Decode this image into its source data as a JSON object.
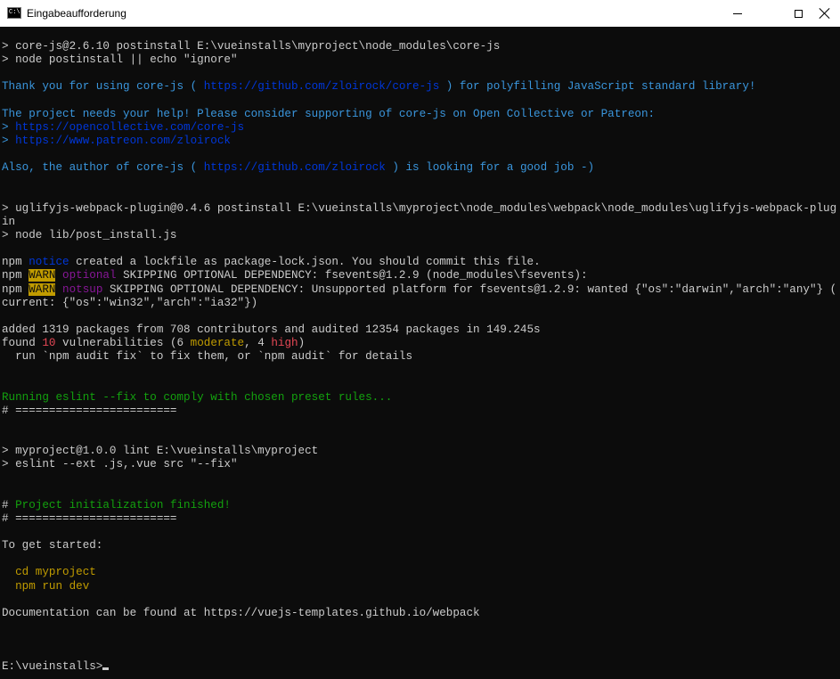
{
  "window": {
    "title": "Eingabeaufforderung",
    "app_icon_text": "C:\\",
    "minimize_glyph": "minimize-icon",
    "maximize_glyph": "maximize-icon",
    "close_glyph": "close-icon"
  },
  "colors": {
    "background": "#0c0c0c",
    "text": "#cccccc",
    "cyan": "#3a96dd",
    "link_blue": "#0037da",
    "yellow": "#c19c00",
    "green": "#13a10e",
    "magenta": "#881798",
    "red": "#e74856"
  },
  "console": {
    "l1": "> core-js@2.6.10 postinstall E:\\vueinstalls\\myproject\\node_modules\\core-js",
    "l2": "> node postinstall || echo \"ignore\"",
    "l3a": "Thank you for using core-js ( ",
    "l3b": "https://github.com/zloirock/core-js",
    "l3c": " ) for polyfilling JavaScript standard library!",
    "l4": "The project needs your help! Please consider supporting of core-js on Open Collective or Patreon:",
    "l5a": "> ",
    "l5b": "https://opencollective.com/core-js",
    "l6a": "> ",
    "l6b": "https://www.patreon.com/zloirock",
    "l7a": "Also, the author of core-js ( ",
    "l7b": "https://github.com/zloirock",
    "l7c": " ) is looking for a good job -)",
    "l8": "> uglifyjs-webpack-plugin@0.4.6 postinstall E:\\vueinstalls\\myproject\\node_modules\\webpack\\node_modules\\uglifyjs-webpack-plug",
    "l9": "in",
    "l10": "> node lib/post_install.js",
    "npm": "npm",
    "notice": "notice",
    "l11": " created a lockfile as package-lock.json. You should commit this file.",
    "warn": "WARN",
    "optional": "optional",
    "l12": " SKIPPING OPTIONAL DEPENDENCY: fsevents@1.2.9 (node_modules\\fsevents):",
    "notsup": "notsup",
    "l13": " SKIPPING OPTIONAL DEPENDENCY: Unsupported platform for fsevents@1.2.9: wanted {\"os\":\"darwin\",\"arch\":\"any\"} (",
    "l14": "current: {\"os\":\"win32\",\"arch\":\"ia32\"})",
    "l15": "added 1319 packages from 708 contributors and audited 12354 packages in 149.245s",
    "l16a": "found ",
    "l16b": "10",
    "l16c": " vulnerabilities (6 ",
    "l16d": "moderate",
    "l16e": ", 4 ",
    "l16f": "high",
    "l16g": ")",
    "l17": "  run `npm audit fix` to fix them, or `npm audit` for details",
    "l18": "Running eslint --fix to comply with chosen preset rules...",
    "l19": "# ========================",
    "l20": "> myproject@1.0.0 lint E:\\vueinstalls\\myproject",
    "l21": "> eslint --ext .js,.vue src \"--fix\"",
    "l22a": "# ",
    "l22b": "Project initialization finished!",
    "l23": "# ========================",
    "l24": "To get started:",
    "l25": "  cd myproject",
    "l26": "  npm run dev",
    "l27": "Documentation can be found at https://vuejs-templates.github.io/webpack",
    "prompt": "E:\\vueinstalls>"
  }
}
